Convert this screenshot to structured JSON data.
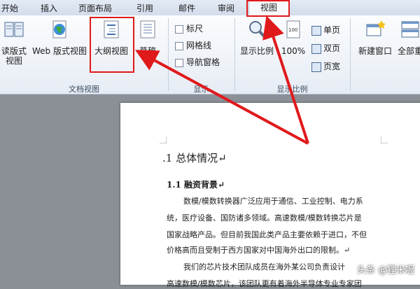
{
  "tabs": [
    "开始",
    "插入",
    "页面布局",
    "引用",
    "邮件",
    "审阅",
    "视图"
  ],
  "active_tab": "视图",
  "ribbon": {
    "doc_views": {
      "label": "文档视图",
      "reading_btn_line1": "读版式",
      "reading_btn_line2": "视图",
      "web_btn": "Web 版式视图",
      "outline_btn": "大纲视图",
      "draft_btn": "草稿"
    },
    "show": {
      "label": "显示",
      "ruler": "标尺",
      "gridlines": "网格线",
      "nav_pane": "导航窗格"
    },
    "zoom": {
      "label": "显示比例",
      "zoom_btn": "显示比例",
      "percent_btn": "100%",
      "one_page": "单页",
      "two_pages": "双页",
      "page_width": "页宽"
    },
    "window": {
      "new_window": "新建窗口",
      "arrange_all": "全部重"
    }
  },
  "document": {
    "heading1": ".1 总体情况↵",
    "heading2": "1.1 融资背景↵",
    "para1_line1": "数模/模数转换器广泛应用于通信、工业控制、电力系",
    "para1_line2": "统，医疗设备、国防诸多领域。高速数模/模数转换芯片是",
    "para1_line3": "国家战略产品。但目前我国此类产品主要依赖于进口，不但",
    "para1_line4": "价格高而且受制于西方国家对中国海外出口的限制。↵",
    "para2_line1": "我们的芯片技术团队成员在海外某公司负责设计",
    "para2_line2": "高速数模/模数芯片，该团队更有着海外半导体专业专家团"
  },
  "watermark": "头条 @狸米喔",
  "colors": {
    "annotation": "#e0191b",
    "ribbon_bg": "#eef2f8",
    "doc_bg": "#8b9097"
  }
}
